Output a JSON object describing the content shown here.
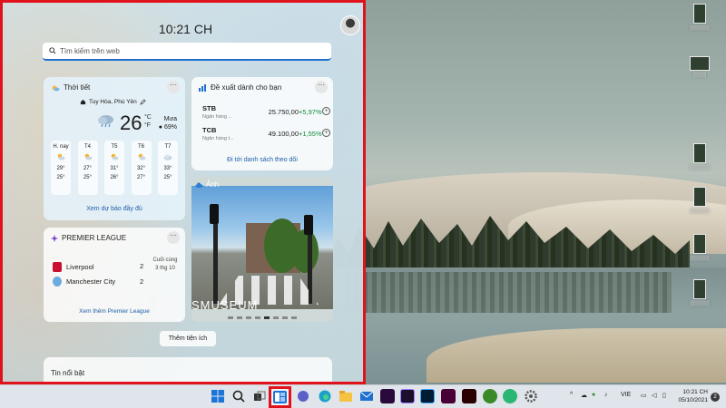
{
  "panel": {
    "time": "10:21 CH",
    "search_placeholder": "Tìm kiếm trên web",
    "add_widgets_label": "Thêm tiện ích"
  },
  "weather": {
    "title": "Thời tiết",
    "location": "Tuy Hòa, Phú Yên",
    "temperature": "26",
    "unit_c": "°C",
    "unit_f": "°F",
    "condition": "Mưa",
    "humidity": "69%",
    "days": [
      {
        "name": "H. nay",
        "hi": "29°",
        "lo": "25°"
      },
      {
        "name": "T4",
        "hi": "27°",
        "lo": "25°"
      },
      {
        "name": "T5",
        "hi": "31°",
        "lo": "26°"
      },
      {
        "name": "T6",
        "hi": "32°",
        "lo": "27°"
      },
      {
        "name": "T7",
        "hi": "33°",
        "lo": "25°"
      }
    ],
    "link": "Xem dự báo đầy đủ"
  },
  "stocks": {
    "title": "Đề xuất dành cho bạn",
    "rows": [
      {
        "symbol": "STB",
        "subtitle": "Ngân hàng ...",
        "price": "25.750,00",
        "change": "+5,97%"
      },
      {
        "symbol": "TCB",
        "subtitle": "Ngân hàng t...",
        "price": "49.100,00",
        "change": "+1,55%"
      }
    ],
    "link": "Đi tới danh sách theo dõi"
  },
  "photos": {
    "title": "Ảnh",
    "caption": "SMUSEUM"
  },
  "league": {
    "title": "PREMIER LEAGUE",
    "teams": [
      {
        "name": "Liverpool",
        "score": "2",
        "color": "#c8102e"
      },
      {
        "name": "Manchester City",
        "score": "2",
        "color": "#6cabdd"
      }
    ],
    "status_line1": "Cuối cùng",
    "status_line2": "3 thg 10",
    "link": "Xem thêm Premier League"
  },
  "news": {
    "title": "Tin nổi bật"
  },
  "taskbar": {
    "language": "VIE",
    "time": "10:21 CH",
    "date": "05/10/2021",
    "notifications": "2"
  },
  "colors": {
    "highlight": "#e0121b",
    "accent": "#1f6fcf",
    "positive": "#148a3c"
  }
}
